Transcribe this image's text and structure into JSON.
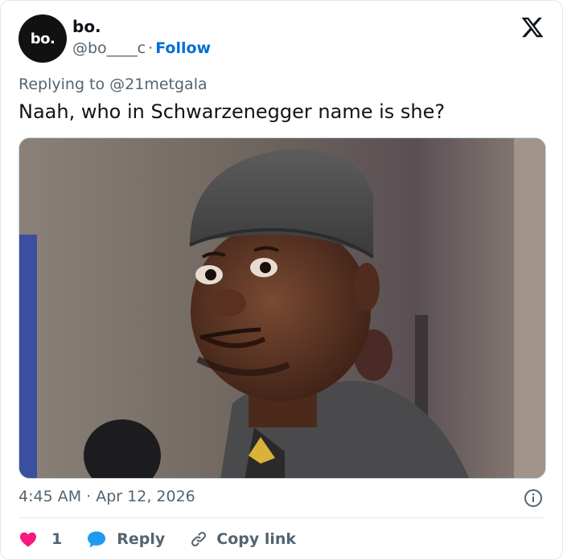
{
  "author": {
    "avatar_text": "bo.",
    "display_name": "bo.",
    "handle": "@bo____c",
    "separator": "·",
    "follow_label": "Follow"
  },
  "reply_context": {
    "prefix": "Replying to",
    "mention": "@21metgala"
  },
  "tweet": {
    "text": "Naah, who in Schwarzenegger name is she?"
  },
  "media": {
    "alt": "photo-of-man-in-grey-cap"
  },
  "meta": {
    "time": "4:45 AM",
    "separator": "·",
    "date": "Apr 12, 2026"
  },
  "actions": {
    "like_count": "1",
    "reply_label": "Reply",
    "copy_label": "Copy link"
  },
  "colors": {
    "like": "#f91880",
    "reply": "#1d9bf0",
    "follow": "#006fd6",
    "muted": "#536471"
  }
}
